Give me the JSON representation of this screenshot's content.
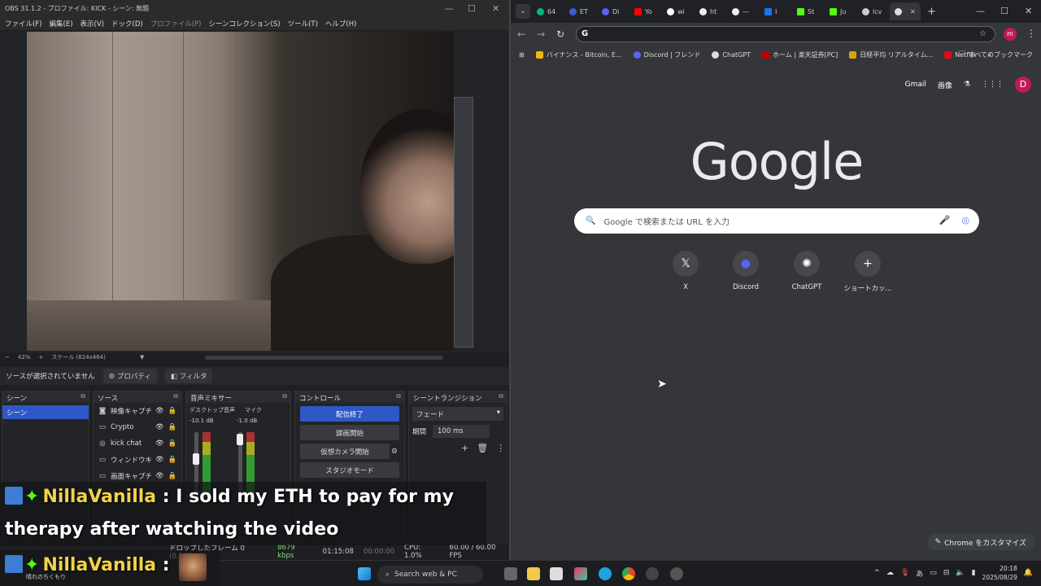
{
  "obs": {
    "title": "OBS 31.1.2 - プロファイル: KICK - シーン: 無題",
    "menu": [
      "ファイル(F)",
      "編集(E)",
      "表示(V)",
      "ドック(D)",
      "プロファイル(P)",
      "シーンコレクション(S)",
      "ツール(T)",
      "ヘルプ(H)"
    ],
    "zoom": "42%",
    "scale": "スケール (824x464)",
    "no_source": "ソースが選択されていません",
    "properties": "プロパティ",
    "filters": "フィルタ",
    "scenes_header": "シーン",
    "scene_selected": "シーン",
    "sources_header": "ソース",
    "sources": [
      "映像キャプチャ",
      "Crypto",
      "kick chat",
      "ウィンドウキャ",
      "画面キャプチャ"
    ],
    "mixer_header": "音声ミキサー",
    "mixer_desktop": "デスクトップ音声",
    "mixer_desktop_db": "-10.1 dB",
    "mixer_mic": "マイク",
    "mixer_mic_db": "-1.0 dB",
    "controls_header": "コントロール",
    "btn_stop_stream": "配信終了",
    "btn_record": "録画開始",
    "btn_virtualcam": "仮想カメラ開始",
    "btn_studio": "スタジオモード",
    "transition_header": "シーントランジション",
    "transition": "フェード",
    "duration_label": "期間",
    "duration": "100 ms",
    "status_dropped": "ドロップしたフレーム 0 (0.0%)",
    "status_kbps": "8679 kbps",
    "status_live": "01:15:08",
    "status_rec": "00:00:00",
    "status_cpu": "CPU: 1.0%",
    "status_fps": "60.00 / 60.00 FPS"
  },
  "chat": {
    "name": "NillaVanilla",
    "message1a": "I sold my ETH to pay for my",
    "message1b": "therapy after watching the video",
    "name2": "NillaVanilla",
    "caption": "晴れのちくもり"
  },
  "chrome": {
    "tabs": [
      "64",
      "ET",
      "Di",
      "Yo",
      "wi",
      "ht",
      "—",
      "I",
      "St",
      "Ju",
      "lcv",
      ""
    ],
    "omnibox_value": "",
    "bookmarks": [
      "バイナンス - Bitcoin, E...",
      "Discord | フレンド",
      "ChatGPT",
      "ホーム | 楽天証券[PC]",
      "日経平均 リアルタイム...",
      "Netflix"
    ],
    "all_bookmarks": "すべてのブックマーク",
    "gmail": "Gmail",
    "images": "画像",
    "avatar": "D",
    "logo": "Google",
    "search_placeholder": "Google で検索または URL を入力",
    "shortcuts": [
      "X",
      "Discord",
      "ChatGPT",
      "ショートカッ..."
    ],
    "customize": "Chrome をカスタマイズ"
  },
  "taskbar": {
    "search": "Search web & PC",
    "ime": "あ",
    "time": "20:18",
    "date": "2025/08/29"
  }
}
